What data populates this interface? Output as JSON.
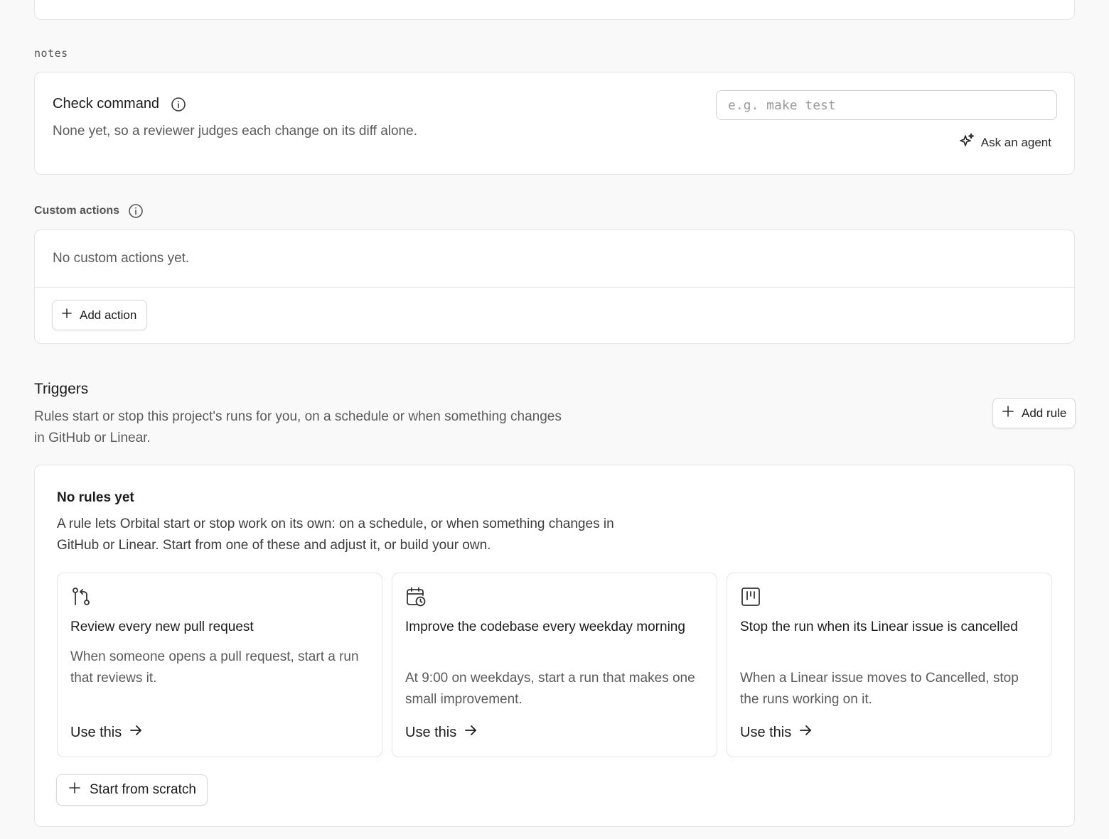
{
  "notes_label": "notes",
  "check_command": {
    "title": "Check command",
    "description": "None yet, so a reviewer judges each change on its diff alone.",
    "input_placeholder": "e.g. make test",
    "input_value": "",
    "ask_agent_label": "Ask an agent"
  },
  "custom_actions": {
    "label": "Custom actions",
    "empty_text": "No custom actions yet.",
    "add_button_label": "Add action"
  },
  "triggers": {
    "title": "Triggers",
    "description": "Rules start or stop this project's runs for you, on a schedule or when something changes in GitHub or Linear.",
    "add_rule_label": "Add rule",
    "empty_title": "No rules yet",
    "empty_description": "A rule lets Orbital start or stop work on its own: on a schedule, or when something changes in GitHub or Linear. Start from one of these and adjust it, or build your own.",
    "templates": [
      {
        "icon": "git-pull-request-icon",
        "title": "Review every new pull request",
        "description": "When someone opens a pull request, start a run that reviews it.",
        "action_label": "Use this"
      },
      {
        "icon": "calendar-clock-icon",
        "title": "Improve the codebase every weekday morning",
        "description": "At 9:00 on weekdays, start a run that makes one small improvement.",
        "action_label": "Use this"
      },
      {
        "icon": "kanban-icon",
        "title": "Stop the run when its Linear issue is cancelled",
        "description": "When a Linear issue moves to Cancelled, stop the runs working on it.",
        "action_label": "Use this"
      }
    ],
    "start_scratch_label": "Start from scratch"
  }
}
